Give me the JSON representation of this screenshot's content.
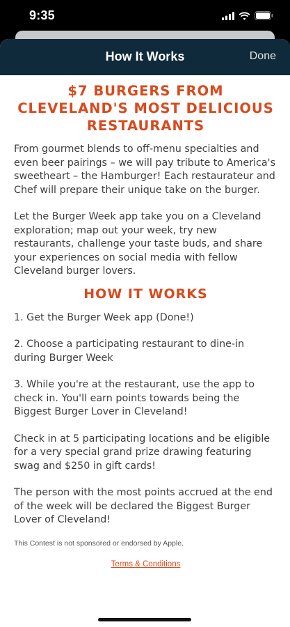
{
  "status_bar": {
    "time": "9:35",
    "icons": [
      "signal-icon",
      "wifi-icon",
      "battery-icon"
    ]
  },
  "nav": {
    "title": "How It Works",
    "done_label": "Done"
  },
  "content": {
    "headline": "$7 BURGERS FROM CLEVELAND'S MOST DELICIOUS RESTAURANTS",
    "intro_1": "From gourmet blends to off-menu specialties and even beer pairings – we will pay tribute to America's sweetheart – the Hamburger! Each restaurateur and Chef will prepare their unique take on the burger.",
    "intro_2": "Let the Burger Week app take you on a Cleveland exploration; map out your week, try new restaurants, challenge your taste buds, and share your experiences on social media with fellow Cleveland burger lovers.",
    "section_title": "HOW IT WORKS",
    "steps": [
      "1. Get the Burger Week app (Done!)",
      "2. Choose a participating restaurant to dine-in during Burger Week",
      "3. While you're at the restaurant, use the app to check in. You'll earn points towards being the Biggest Burger Lover in Cleveland!",
      "Check in at 5 participating locations and be eligible for a very special grand prize drawing featuring swag and $250 in gift cards!",
      "The person with the most points accrued at the end of the week will be declared the Biggest Burger Lover of Cleveland!"
    ],
    "disclaimer": "This Contest is not sponsored or endorsed by Apple.",
    "terms_label": "Terms & Conditions"
  },
  "colors": {
    "accent": "#d94a1e",
    "nav_background": "#0f2a3a",
    "body_text": "#3d3d3d"
  }
}
